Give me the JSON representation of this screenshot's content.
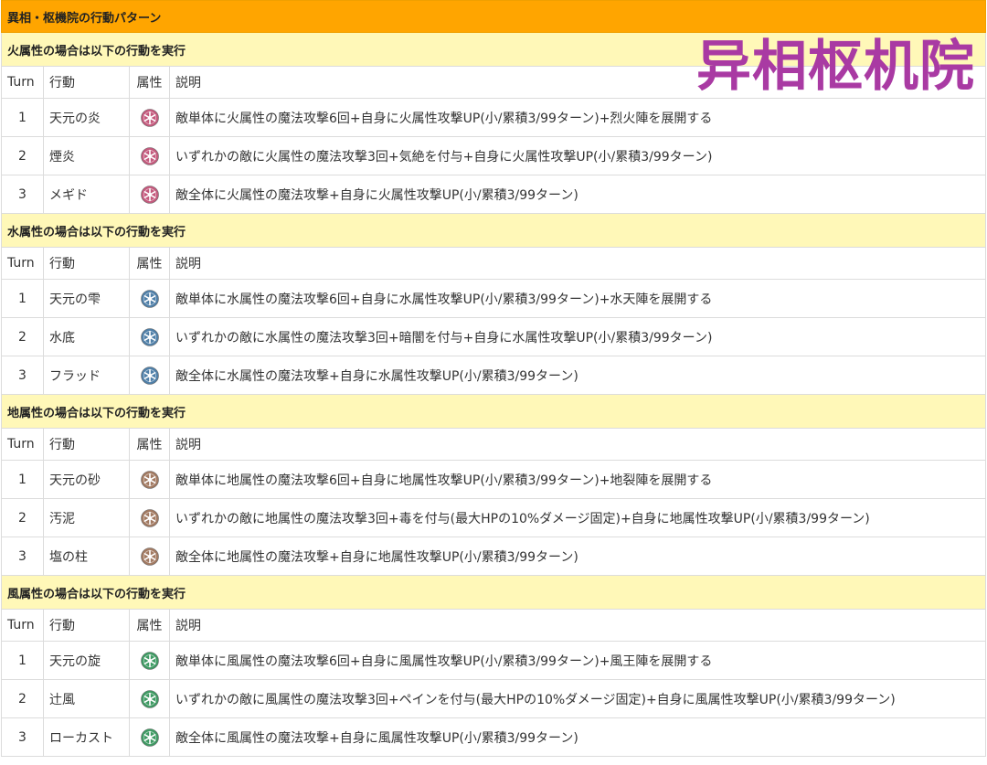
{
  "title": "異相・枢機院の行動パターン",
  "watermark": "异相枢机院",
  "columns": {
    "turn": "Turn",
    "action": "行動",
    "attr": "属性",
    "desc": "説明"
  },
  "colors": {
    "title_bg": "#ffa500",
    "section_bg": "#fff8b8",
    "watermark": "#a93aa3",
    "fire": "#c45a7d",
    "water": "#4f7fa8",
    "earth": "#a27a62",
    "wind": "#3f9a63"
  },
  "sections": [
    {
      "header": "火属性の場合は以下の行動を実行",
      "icon": "fire-attribute-icon",
      "rows": [
        {
          "turn": "1",
          "action": "天元の炎",
          "desc": "敵単体に火属性の魔法攻撃6回+自身に火属性攻撃UP(小/累積3/99ターン)+烈火陣を展開する"
        },
        {
          "turn": "2",
          "action": "煙炎",
          "desc": "いずれかの敵に火属性の魔法攻撃3回+気絶を付与+自身に火属性攻撃UP(小/累積3/99ターン)"
        },
        {
          "turn": "3",
          "action": "メギド",
          "desc": "敵全体に火属性の魔法攻撃+自身に火属性攻撃UP(小/累積3/99ターン)"
        }
      ]
    },
    {
      "header": "水属性の場合は以下の行動を実行",
      "icon": "water-attribute-icon",
      "rows": [
        {
          "turn": "1",
          "action": "天元の雫",
          "desc": "敵単体に水属性の魔法攻撃6回+自身に水属性攻撃UP(小/累積3/99ターン)+水天陣を展開する"
        },
        {
          "turn": "2",
          "action": "水底",
          "desc": "いずれかの敵に水属性の魔法攻撃3回+暗闇を付与+自身に水属性攻撃UP(小/累積3/99ターン)"
        },
        {
          "turn": "3",
          "action": "フラッド",
          "desc": "敵全体に水属性の魔法攻撃+自身に水属性攻撃UP(小/累積3/99ターン)"
        }
      ]
    },
    {
      "header": "地属性の場合は以下の行動を実行",
      "icon": "earth-attribute-icon",
      "rows": [
        {
          "turn": "1",
          "action": "天元の砂",
          "desc": "敵単体に地属性の魔法攻撃6回+自身に地属性攻撃UP(小/累積3/99ターン)+地裂陣を展開する"
        },
        {
          "turn": "2",
          "action": "汚泥",
          "desc": "いずれかの敵に地属性の魔法攻撃3回+毒を付与(最大HPの10%ダメージ固定)+自身に地属性攻撃UP(小/累積3/99ターン)"
        },
        {
          "turn": "3",
          "action": "塩の柱",
          "desc": "敵全体に地属性の魔法攻撃+自身に地属性攻撃UP(小/累積3/99ターン)"
        }
      ]
    },
    {
      "header": "風属性の場合は以下の行動を実行",
      "icon": "wind-attribute-icon",
      "rows": [
        {
          "turn": "1",
          "action": "天元の旋",
          "desc": "敵単体に風属性の魔法攻撃6回+自身に風属性攻撃UP(小/累積3/99ターン)+風王陣を展開する"
        },
        {
          "turn": "2",
          "action": "辻風",
          "desc": "いずれかの敵に風属性の魔法攻撃3回+ペインを付与(最大HPの10%ダメージ固定)+自身に風属性攻撃UP(小/累積3/99ターン)"
        },
        {
          "turn": "3",
          "action": "ローカスト",
          "desc": "敵全体に風属性の魔法攻撃+自身に風属性攻撃UP(小/累積3/99ターン)"
        }
      ]
    }
  ]
}
